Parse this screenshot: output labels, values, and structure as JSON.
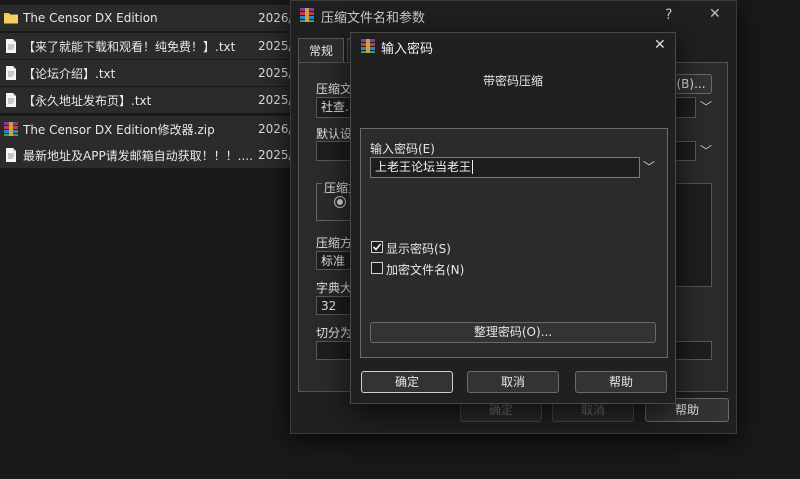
{
  "file_list": [
    {
      "name": "The Censor DX Edition",
      "date": "2026/",
      "icon": "folder-icon"
    },
    {
      "name": "【来了就能下载和观看！纯免费！】.txt",
      "date": "2025/",
      "icon": "text-file-icon"
    },
    {
      "name": "【论坛介绍】.txt",
      "date": "2025/",
      "icon": "text-file-icon"
    },
    {
      "name": "【永久地址发布页】.txt",
      "date": "2025/",
      "icon": "text-file-icon"
    },
    {
      "name": "The Censor DX Edition修改器.zip",
      "date": "2026/",
      "icon": "winrar-archive-icon"
    },
    {
      "name": "最新地址及APP请发邮箱自动获取！！！....",
      "date": "2025/",
      "icon": "text-file-icon"
    }
  ],
  "back_dialog": {
    "title": "压缩文件名和参数",
    "help_glyph": "?",
    "close_glyph": "✕",
    "tab_general": "常规",
    "archive_name_label": "压缩文",
    "archive_name_value": "社查.r",
    "browse_button": "(B)...",
    "default_profile_label": "默认设",
    "format_group_label": "压缩文",
    "method_label": "压缩方",
    "method_value": "标准",
    "dict_label": "字典大",
    "dict_value": "32",
    "split_label": "切分为",
    "ok_button": "确定",
    "cancel_button": "取消",
    "help_button": "帮助"
  },
  "password_dialog": {
    "title": "输入密码",
    "close_glyph": "✕",
    "subtitle": "带密码压缩",
    "password_label": "输入密码(E)",
    "password_value": "上老王论坛当老王",
    "show_password_label": "显示密码(S)",
    "show_password_checked": true,
    "encrypt_filenames_label": "加密文件名(N)",
    "encrypt_filenames_checked": false,
    "organize_button": "整理密码(O)...",
    "ok_button": "确定",
    "cancel_button": "取消",
    "help_button": "帮助"
  }
}
